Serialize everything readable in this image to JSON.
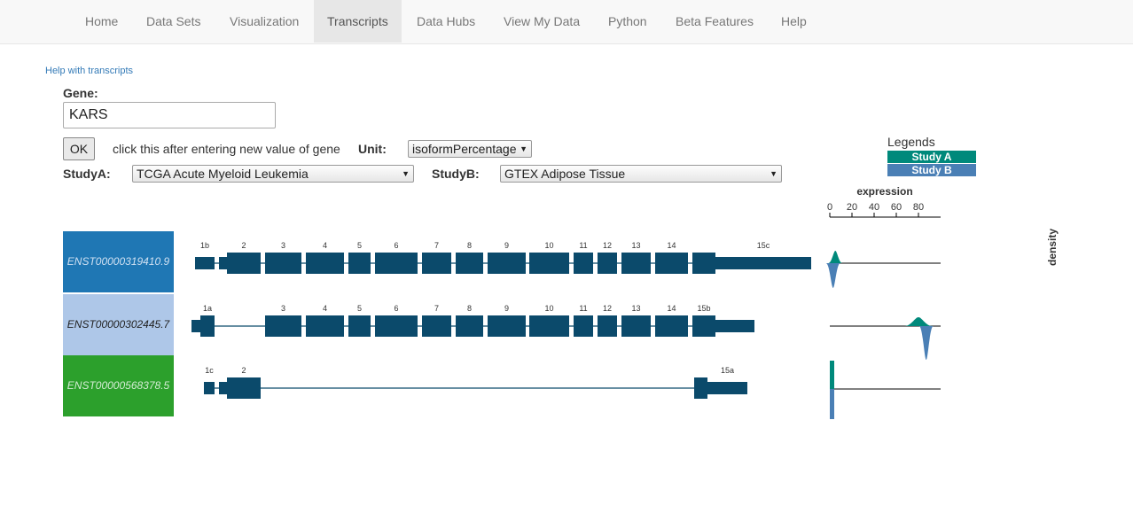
{
  "nav": {
    "items": [
      {
        "label": "Home",
        "active": false
      },
      {
        "label": "Data Sets",
        "active": false
      },
      {
        "label": "Visualization",
        "active": false
      },
      {
        "label": "Transcripts",
        "active": true
      },
      {
        "label": "Data Hubs",
        "active": false
      },
      {
        "label": "View My Data",
        "active": false
      },
      {
        "label": "Python",
        "active": false
      },
      {
        "label": "Beta Features",
        "active": false
      },
      {
        "label": "Help",
        "active": false
      }
    ]
  },
  "help_link": "Help with transcripts",
  "form": {
    "gene_label": "Gene:",
    "gene_value": "KARS",
    "ok_label": "OK",
    "hint": "click this after entering new value of gene",
    "unit_label": "Unit:",
    "unit_value": "isoformPercentage",
    "studyA_label": "StudyA:",
    "studyA_value": "TCGA Acute Myeloid Leukemia",
    "studyB_label": "StudyB:",
    "studyB_value": "GTEX Adipose Tissue"
  },
  "legend": {
    "title": "Legends",
    "items": [
      {
        "label": "Study A",
        "color": "#00897b"
      },
      {
        "label": "Study B",
        "color": "#4a7fb5"
      }
    ]
  },
  "transcripts": [
    {
      "id": "ENST00000319410.9",
      "color": "#1f77b4",
      "text_color": "#cfe0f2",
      "exon_labels": [
        "1b",
        "2",
        "3",
        "4",
        "5",
        "6",
        "7",
        "8",
        "9",
        "10",
        "11",
        "12",
        "13",
        "14",
        "15c"
      ]
    },
    {
      "id": "ENST00000302445.7",
      "color": "#aec7e8",
      "text_color": "#222222",
      "exon_labels": [
        "1a",
        "3",
        "4",
        "5",
        "6",
        "7",
        "8",
        "9",
        "10",
        "11",
        "12",
        "13",
        "14",
        "15b"
      ]
    },
    {
      "id": "ENST00000568378.5",
      "color": "#2ca02c",
      "text_color": "#d4ecd4",
      "exon_labels": [
        "1c",
        "2",
        "15a"
      ]
    }
  ],
  "exon_color": "#0b4a6b",
  "chart_data": {
    "type": "area",
    "title": "expression",
    "xlabel": "expression",
    "ylabel": "density",
    "x_ticks": [
      0,
      20,
      40,
      60,
      80
    ],
    "xlim": [
      0,
      100
    ],
    "series": [
      {
        "name": "Study A",
        "color": "#00897b",
        "peaks": [
          {
            "transcript": "ENST00000319410.9",
            "x": 5
          },
          {
            "transcript": "ENST00000302445.7",
            "x": 80
          },
          {
            "transcript": "ENST00000568378.5",
            "x": 0
          }
        ]
      },
      {
        "name": "Study B",
        "color": "#4a7fb5",
        "peaks": [
          {
            "transcript": "ENST00000319410.9",
            "x": 3
          },
          {
            "transcript": "ENST00000302445.7",
            "x": 87
          },
          {
            "transcript": "ENST00000568378.5",
            "x": 0
          }
        ]
      }
    ]
  }
}
